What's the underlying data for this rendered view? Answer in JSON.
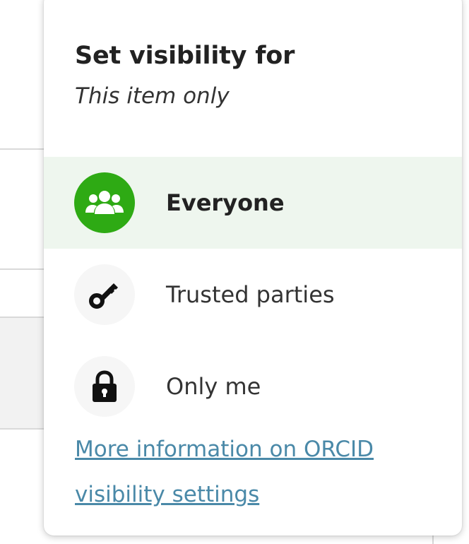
{
  "popover": {
    "title": "Set visibility for",
    "subtitle": "This item only",
    "options": [
      {
        "label": "Everyone",
        "icon": "group-icon",
        "selected": true
      },
      {
        "label": "Trusted parties",
        "icon": "key-icon",
        "selected": false
      },
      {
        "label": "Only me",
        "icon": "lock-icon",
        "selected": false
      }
    ],
    "more_info_link": "More information on ORCID visibility settings"
  },
  "colors": {
    "selected_icon_bg": "#2eaa14",
    "selected_row_bg": "#eef6ee",
    "link": "#4a89a8"
  }
}
